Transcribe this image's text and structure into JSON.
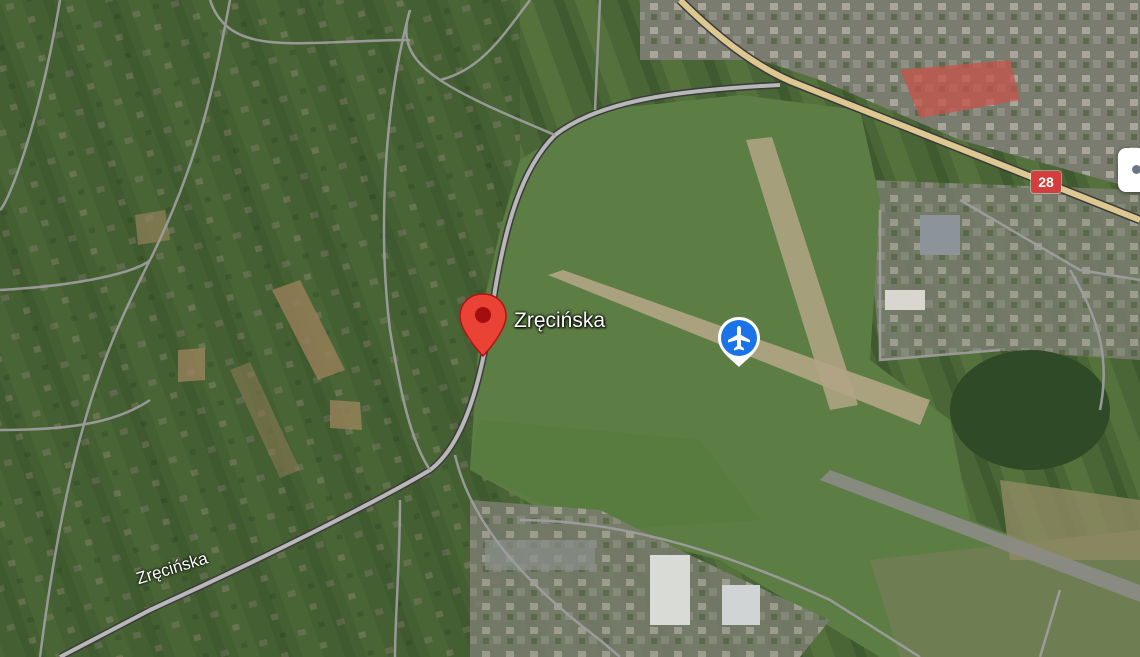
{
  "map": {
    "type": "satellite",
    "colors": {
      "fields": "#4f6a3a",
      "airfield_grass": "#5e7f45",
      "runway": "#b9a98a",
      "main_road": "#d8c48a",
      "roads": "#9a9a9a",
      "pin_red": "#ea4335",
      "airport_blue": "#1a73e8",
      "shield_red": "#d43d3d"
    }
  },
  "pin": {
    "label": "Zręcińska",
    "icon": "map-pin-icon"
  },
  "airport": {
    "icon": "airplane-icon"
  },
  "road_shield": {
    "number": "28"
  },
  "street_label": {
    "text": "Zręcińska"
  },
  "controls": {
    "icon": "street-view-icon"
  }
}
